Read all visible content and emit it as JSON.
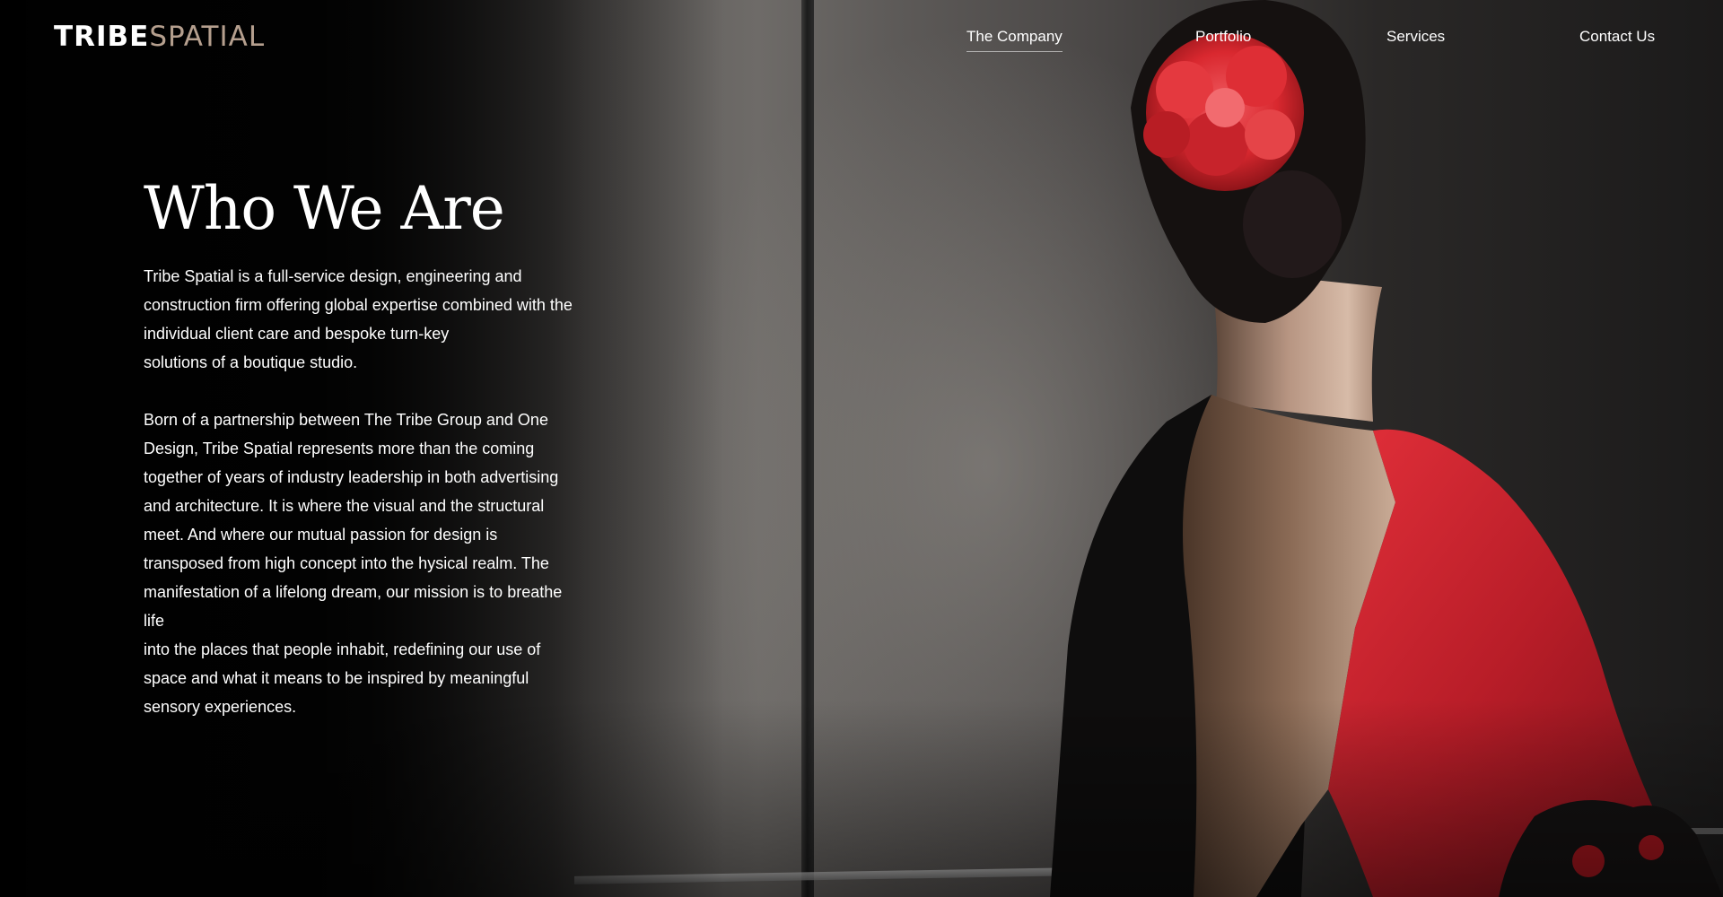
{
  "brand": {
    "logo_part1": "TRIBE",
    "logo_part2": "SPATIAL",
    "logo_color_primary": "#ffffff",
    "logo_color_accent": "#b59f8e"
  },
  "nav": {
    "items": [
      {
        "label": "The Company",
        "active": true
      },
      {
        "label": "Portfolio",
        "active": false
      },
      {
        "label": "Services",
        "active": false
      },
      {
        "label": "Contact Us",
        "active": false
      }
    ]
  },
  "hero": {
    "heading": "Who We Are",
    "paragraph1": [
      "Tribe Spatial is a full-service design, engineering and",
      "construction firm offering global expertise combined with the",
      "individual client care and bespoke turn-key",
      "solutions of a boutique studio."
    ],
    "paragraph2": [
      "Born of a partnership between The Tribe Group and One",
      "Design, Tribe Spatial represents more than the coming",
      "together of years of industry leadership in both advertising",
      "and architecture. It is where the visual and the structural",
      "meet. And where our mutual passion for design is",
      "transposed from high concept into the hysical realm. The",
      "manifestation of a lifelong dream, our mission is to breathe",
      "life",
      "into the places that people inhabit, redefining our use of",
      "space and what it means to be inspired by meaningful",
      "sensory experiences."
    ],
    "background_image": "woman-in-red-flamenco-dress-with-red-flower-photo",
    "accent_color": "#d3262f"
  }
}
